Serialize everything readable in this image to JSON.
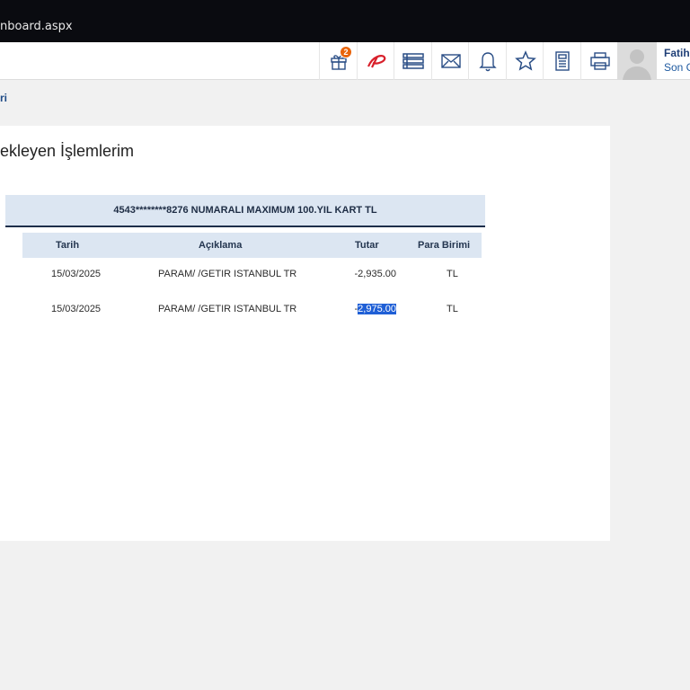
{
  "browser": {
    "url_fragment": "nboard.aspx"
  },
  "header": {
    "gift_badge_count": "2",
    "icons": [
      "gift-icon",
      "param-logo-icon",
      "list-icon",
      "mail-icon",
      "bell-icon",
      "star-icon",
      "calculator-icon",
      "printer-icon"
    ],
    "user_name": "Fatih",
    "user_sub": "Son G"
  },
  "breadcrumb": {
    "text": "ri"
  },
  "page": {
    "title": "ekleyen İşlemlerim"
  },
  "card": {
    "title": "4543********8276 NUMARALI MAXIMUM 100.YIL KART TL",
    "columns": {
      "date": "Tarih",
      "description": "Açıklama",
      "amount": "Tutar",
      "currency": "Para Birimi"
    },
    "rows": [
      {
        "date": "15/03/2025",
        "description": "PARAM/ /GETIR ISTANBUL TR",
        "amount_prefix": "",
        "amount": "-2,935.00",
        "currency": "TL"
      },
      {
        "date": "15/03/2025",
        "description": "PARAM/ /GETIR ISTANBUL TR",
        "amount_prefix": "-",
        "amount": "2,975.00",
        "currency": "TL"
      }
    ]
  },
  "colors": {
    "accent": "#1f4b86",
    "header_bg": "#dce6f2",
    "badge": "#e8630a",
    "selection": "#1f5fd6"
  }
}
